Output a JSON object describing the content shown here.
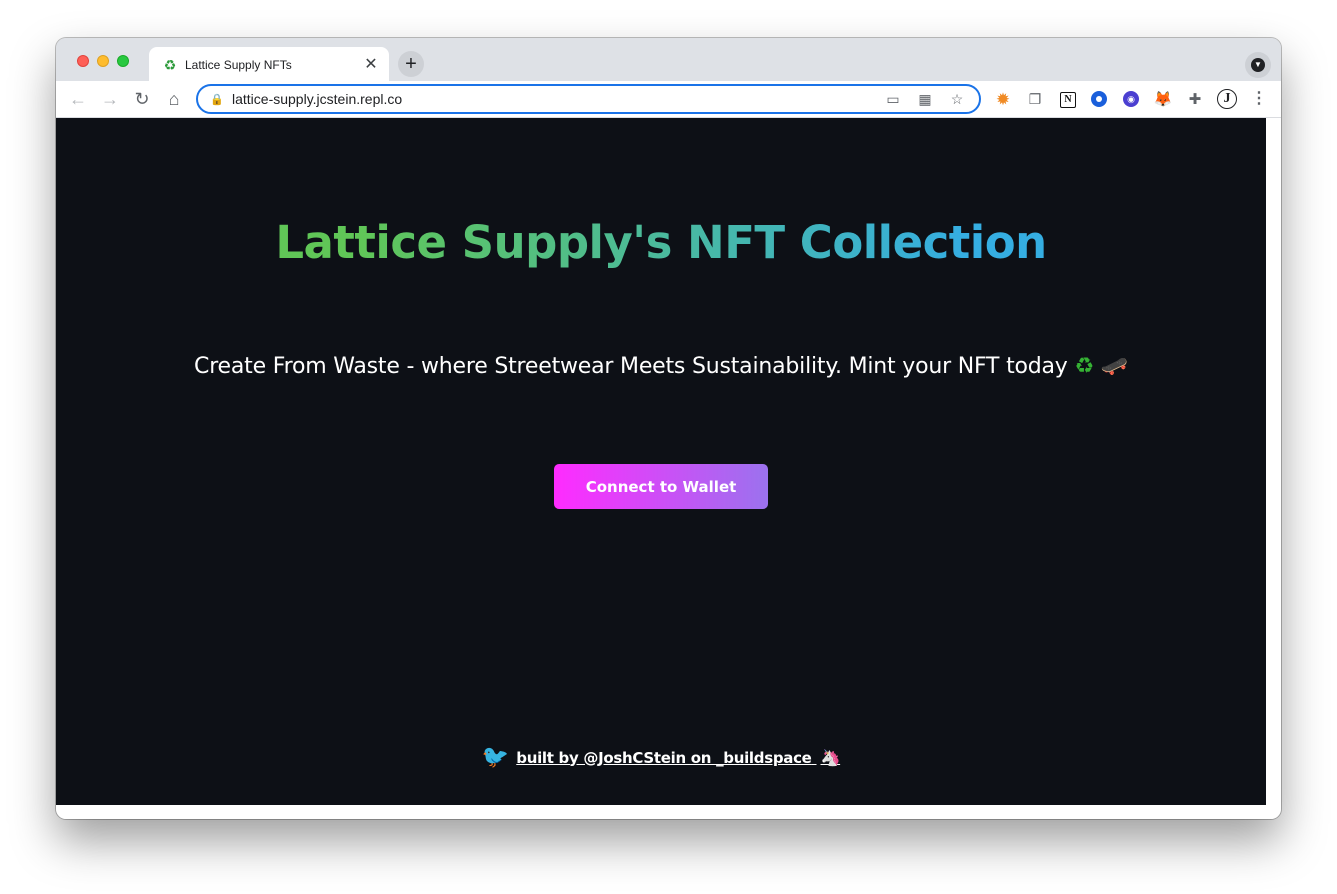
{
  "browser": {
    "tab": {
      "favicon": "recycle-icon",
      "favicon_glyph": "♻",
      "title": "Lattice Supply NFTs",
      "close_glyph": "✕"
    },
    "new_tab_glyph": "+",
    "tab_search_glyph": "▼",
    "toolbar": {
      "back_glyph": "←",
      "forward_glyph": "→",
      "reload_glyph": "↻",
      "home_glyph": "⌂",
      "url": "lattice-supply.jcstein.repl.co",
      "lock_glyph": "🔒",
      "cast_glyph": "▭",
      "qr_glyph": "▦",
      "star_glyph": "☆"
    },
    "extensions": {
      "sun_glyph": "✹",
      "tabs_glyph": "❐",
      "notion_glyph": "N",
      "purple_glyph": "◉",
      "fox_glyph": "🦊",
      "puzzle_glyph": "✚",
      "profile_initial": "J",
      "menu_glyph": "⋮"
    }
  },
  "page": {
    "headline": "Lattice Supply's NFT Collection",
    "tagline": "Create From Waste - where Streetwear Meets Sustainability. Mint your NFT today",
    "tagline_emoji_1": "♻",
    "tagline_emoji_2": "🛹",
    "connect_button_label": "Connect to Wallet",
    "footer": {
      "twitter_icon_glyph": "🐦",
      "link_text": "built by @JoshCStein on _buildspace",
      "unicorn_glyph": "🦄"
    }
  },
  "colors": {
    "page_background": "#0d1016",
    "headline_gradient_start": "#60c657",
    "headline_gradient_end": "#35aee2",
    "button_gradient_start": "#ff2bff",
    "button_gradient_end": "#9b72ee",
    "omnibox_focus": "#1a73e8"
  }
}
